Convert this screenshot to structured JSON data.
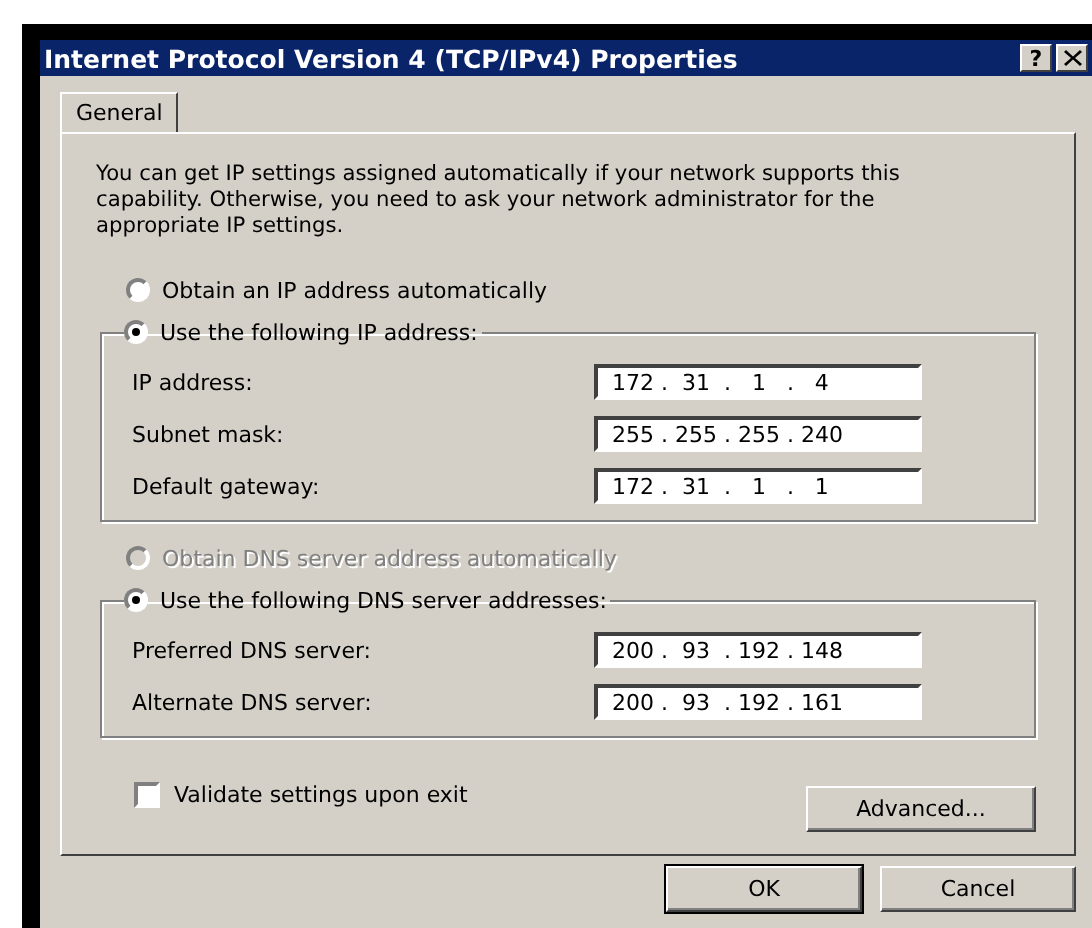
{
  "window": {
    "title": "Internet Protocol Version 4 (TCP/IPv4) Properties",
    "help_button": "?"
  },
  "tabs": [
    {
      "label": "General",
      "selected": true
    }
  ],
  "description": "You can get IP settings assigned automatically if your network supports this capability. Otherwise, you need to ask your network administrator for the appropriate IP settings.",
  "sections": [
    {
      "auto_option": {
        "label": "Obtain an IP address automatically",
        "selected": false,
        "disabled": false
      },
      "manual_option": {
        "label": "Use the following IP address:",
        "selected": true,
        "disabled": false
      },
      "fields": [
        {
          "label": "IP address:",
          "value": "172 .  31  .   1   .   4"
        },
        {
          "label": "Subnet mask:",
          "value": "255 . 255 . 255 . 240"
        },
        {
          "label": "Default gateway:",
          "value": "172 .  31  .   1   .   1"
        }
      ]
    },
    {
      "auto_option": {
        "label": "Obtain DNS server address automatically",
        "selected": false,
        "disabled": true
      },
      "manual_option": {
        "label": "Use the following DNS server addresses:",
        "selected": true,
        "disabled": false
      },
      "fields": [
        {
          "label": "Preferred DNS server:",
          "value": "200 .  93  . 192 . 148"
        },
        {
          "label": "Alternate DNS server:",
          "value": "200 .  93  . 192 . 161"
        }
      ]
    }
  ],
  "validate": {
    "label": "Validate settings upon exit",
    "checked": false
  },
  "advanced_button": "Advanced...",
  "buttons": [
    "OK",
    "Cancel"
  ]
}
